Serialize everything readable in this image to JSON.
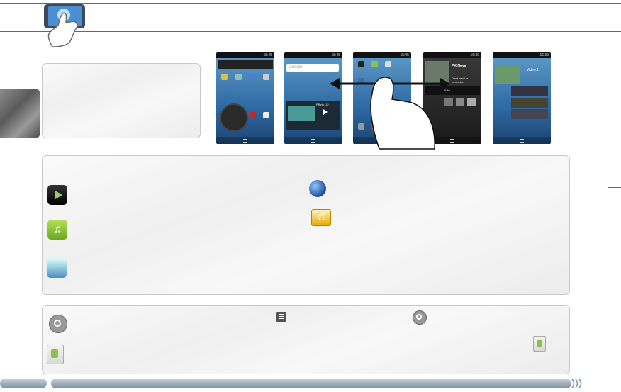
{
  "header": {
    "logo_icon": "touch-hand-icon"
  },
  "screens": [
    {
      "time": "15:45"
    },
    {
      "time": "15:45",
      "search_placeholder": "Google",
      "widget_title": "PRelo_12"
    },
    {
      "time": "15:45"
    },
    {
      "time": "16:39",
      "title": "PK Nova",
      "subtitle": "Don't want to remember",
      "position": "0:10"
    },
    {
      "time": "16:39",
      "title": "Video 1"
    }
  ],
  "apps_panel": {
    "icons": [
      "video-icon",
      "music-icon",
      "photo-icon",
      "browser-globe-icon",
      "email-icon"
    ]
  },
  "bottom_panel": {
    "icons": [
      "settings-icon",
      "menu-icon",
      "settings-small-icon",
      "appslib-icon",
      "appslib-small-icon"
    ]
  },
  "colors": {
    "accent": "#7d8f9e",
    "frame": "#666666"
  }
}
